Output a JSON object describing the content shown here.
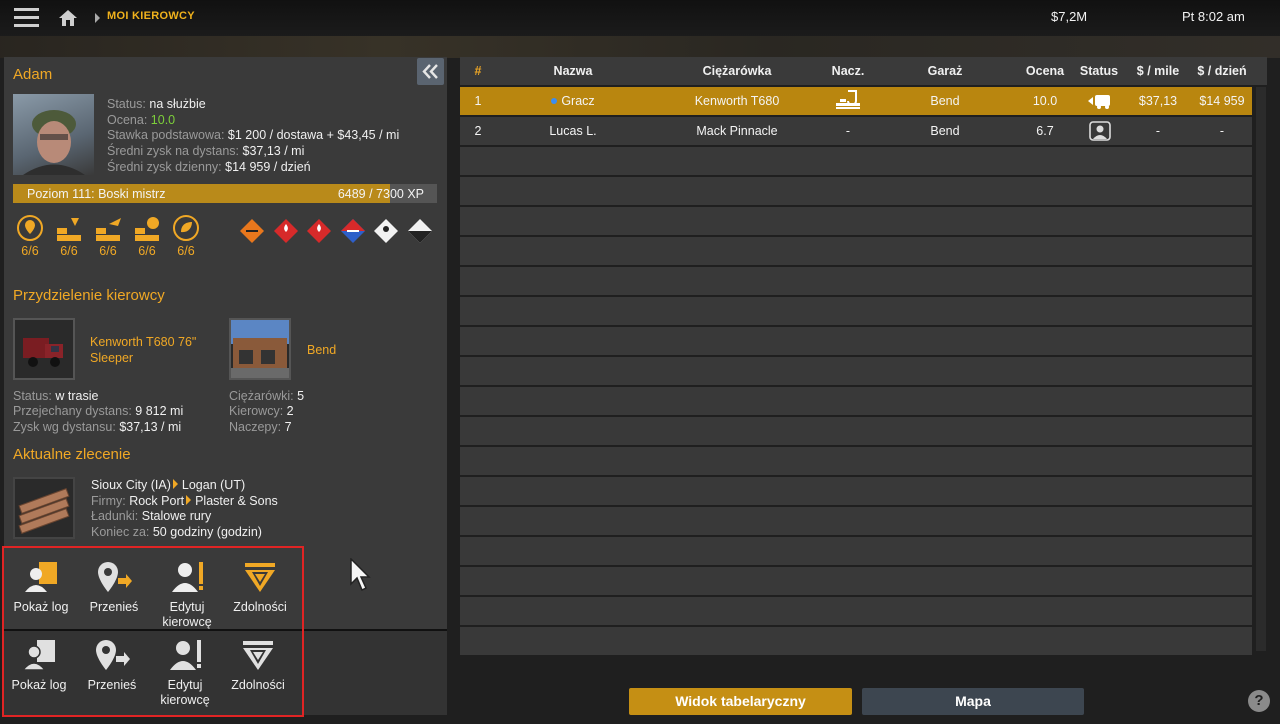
{
  "topbar": {
    "crumb": "MOI KIEROWCY",
    "money": "$7,2M",
    "clock": "Pt 8:02 am"
  },
  "driver": {
    "name": "Adam",
    "status_label": "Status:",
    "status": "na służbie",
    "rating_label": "Ocena:",
    "rating": "10.0",
    "pay_label": "Stawka podstawowa:",
    "pay": "$1 200 / dostawa + $43,45 / mi",
    "avg_dist_label": "Średni zysk na dystans:",
    "avg_dist": "$37,13 / mi",
    "avg_day_label": "Średni zysk dzienny:",
    "avg_day": "$14 959 / dzień",
    "level": "Poziom 111: Boski mistrz",
    "xp": "6489 / 7300 XP",
    "xp_progress": 0.889,
    "skills": [
      "6/6",
      "6/6",
      "6/6",
      "6/6",
      "6/6"
    ],
    "adr_icons": [
      "explosives-icon",
      "flammable-gas-icon",
      "flammable-liquid-icon",
      "dangerous-when-wet-icon",
      "toxic-icon",
      "corrosive-icon"
    ]
  },
  "assignment": {
    "title": "Przydzielenie kierowcy",
    "truck": "Kenworth T680 76\" Sleeper",
    "garage": "Bend",
    "status_label": "Status:",
    "status": "w trasie",
    "dist_label": "Przejechany dystans:",
    "dist": "9 812 mi",
    "profit_label": "Zysk wg dystansu:",
    "profit": "$37,13 / mi",
    "trucks_label": "Ciężarówki:",
    "trucks": "5",
    "drivers_label": "Kierowcy:",
    "drivers": "2",
    "trailers_label": "Naczepy:",
    "trailers": "7"
  },
  "job": {
    "title": "Aktualne zlecenie",
    "from": "Sioux City (IA)",
    "to": "Logan (UT)",
    "companies_label": "Firmy:",
    "company_from": "Rock Port",
    "company_to": "Plaster & Sons",
    "cargo_label": "Ładunki:",
    "cargo": "Stalowe rury",
    "ends_label": "Koniec za:",
    "ends": "50 godziny (godzin)"
  },
  "actions": {
    "row1": [
      "Pokaż log",
      "Przenieś",
      "Edytuj kierowcę",
      "Zdolności"
    ],
    "row2": [
      "Pokaż log",
      "Przenieś",
      "Edytuj kierowcę",
      "Zdolności"
    ]
  },
  "table": {
    "headers": [
      "#",
      "Nazwa",
      "Ciężarówka",
      "Nacz.",
      "Garaż",
      "Ocena",
      "Status",
      "$ / mile",
      "$ / dzień"
    ],
    "rows": [
      [
        "1",
        "Gracz",
        "Kenworth T680",
        "",
        "Bend",
        "10.0",
        "",
        "$37,13",
        "$14 959"
      ],
      [
        "2",
        "Lucas L.",
        "Mack Pinnacle",
        "-",
        "Bend",
        "6.7",
        "",
        "-",
        "-"
      ]
    ]
  },
  "bottom": {
    "table_view": "Widok tabelaryczny",
    "map": "Mapa",
    "help": "?"
  },
  "colors": {
    "accent": "#f0a825",
    "selected_row": "#b9860f",
    "highlight_box": "#e02424"
  }
}
